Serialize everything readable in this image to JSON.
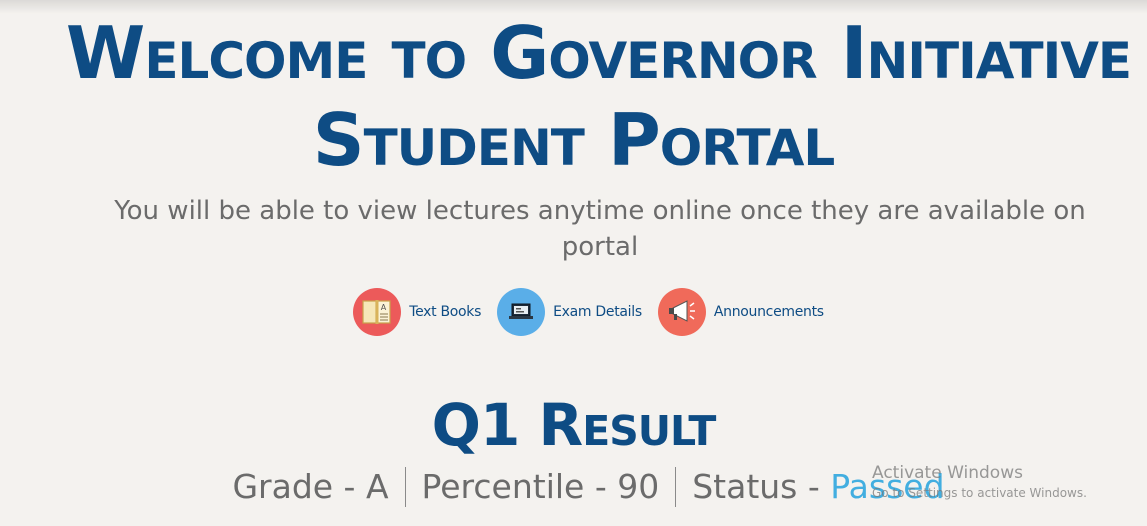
{
  "header": {
    "title_line1": "Welcome to Governor Initiative",
    "title_line2": "Student Portal",
    "subtitle": "You will be able to view lectures anytime online once they are available on portal"
  },
  "quick_links": [
    {
      "label": "Text Books",
      "icon": "book-icon",
      "color": "#ec5a5a"
    },
    {
      "label": "Exam Details",
      "icon": "laptop-icon",
      "color": "#5aaee8"
    },
    {
      "label": "Announcements",
      "icon": "megaphone-icon",
      "color": "#f06a5a"
    }
  ],
  "result": {
    "title": "Q1 Result",
    "grade": "Grade - A",
    "percentile": "Percentile - 90",
    "status_label": "Status - ",
    "status_value": "Passed"
  },
  "watermark": {
    "title": "Activate Windows",
    "subtitle": "Go to Settings to activate Windows."
  },
  "colors": {
    "brand": "#0e4c84",
    "status_passed": "#42aee0",
    "background": "#f4f2ef"
  }
}
